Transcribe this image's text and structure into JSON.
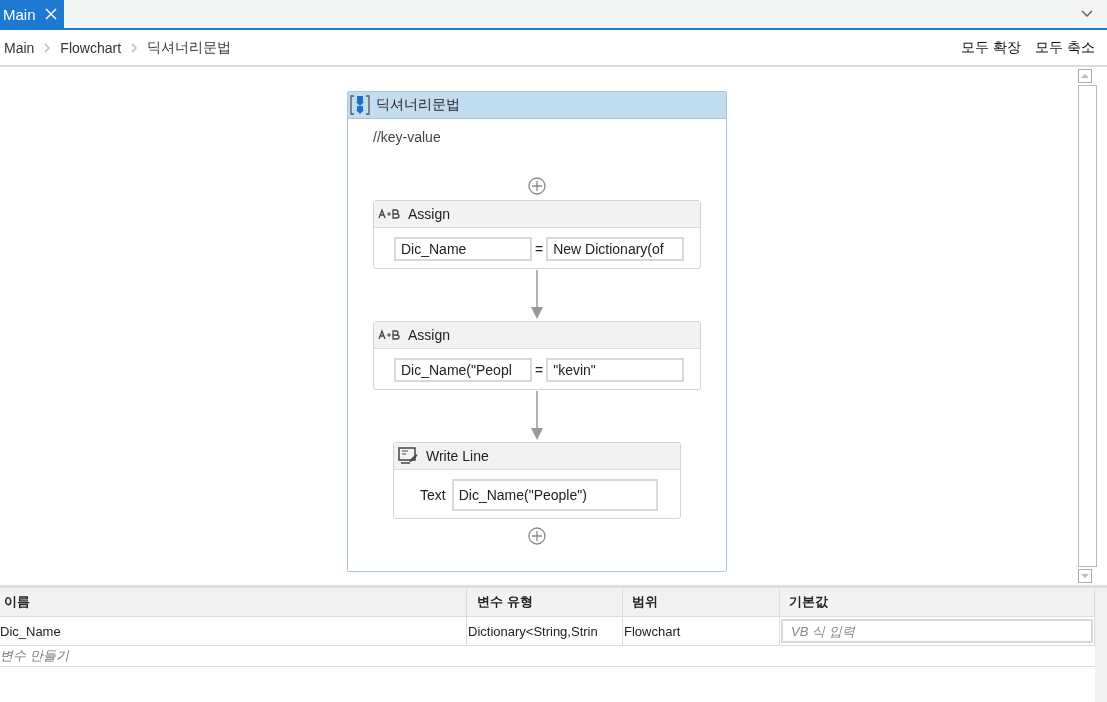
{
  "tabs": [
    {
      "label": "Main",
      "selected": true
    }
  ],
  "breadcrumb": [
    "Main",
    "Flowchart",
    "딕셔너리문법"
  ],
  "header_actions": [
    "모두 확장",
    "모두 축소"
  ],
  "sequence": {
    "title": "딕셔너리문법",
    "comment": "//key-value",
    "activities": [
      {
        "kind": "assign",
        "title": "Assign",
        "to": "Dic_Name",
        "operator": "=",
        "value": "New Dictionary(of"
      },
      {
        "kind": "assign",
        "title": "Assign",
        "to": "Dic_Name(\"Peopl",
        "operator": "=",
        "value": "\"kevin\""
      },
      {
        "kind": "writeline",
        "title": "Write Line",
        "label": "Text",
        "value": "Dic_Name(\"People\")"
      }
    ]
  },
  "variables": {
    "columns": [
      "이름",
      "변수 유형",
      "범위",
      "기본값"
    ],
    "rows": [
      {
        "name": "Dic_Name",
        "type": "Dictionary<String,Strin",
        "scope": "Flowchart",
        "default_placeholder": "VB 식 입력"
      }
    ],
    "create_label": "변수 만들기"
  }
}
